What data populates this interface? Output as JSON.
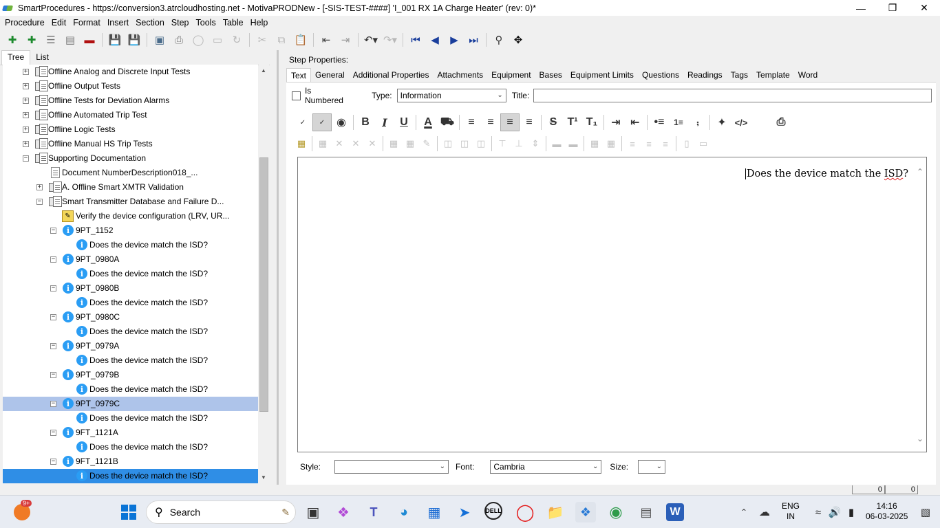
{
  "window": {
    "title": "SmartProcedures - https://conversion3.atrcloudhosting.net - MotivaPRODNew - [-SIS-TEST-####] 'I_001 RX 1A Charge Heater' (rev: 0)*"
  },
  "menu": [
    "Procedure",
    "Edit",
    "Format",
    "Insert",
    "Section",
    "Step",
    "Tools",
    "Table",
    "Help"
  ],
  "left_tabs": [
    "Tree",
    "List"
  ],
  "tree": [
    {
      "label": "Offline Analog and Discrete Input Tests",
      "indent": 0,
      "exp": "+",
      "icon": "doc"
    },
    {
      "label": "Offline Output Tests",
      "indent": 0,
      "exp": "+",
      "icon": "doc"
    },
    {
      "label": "Offline Tests for Deviation Alarms",
      "indent": 0,
      "exp": "+",
      "icon": "doc"
    },
    {
      "label": "Offline Automated Trip Test",
      "indent": 0,
      "exp": "+",
      "icon": "doc"
    },
    {
      "label": "Offline Logic Tests",
      "indent": 0,
      "exp": "+",
      "icon": "doc"
    },
    {
      "label": "Offline Manual HS Trip Tests",
      "indent": 0,
      "exp": "+",
      "icon": "doc"
    },
    {
      "label": "Supporting Documentation",
      "indent": 0,
      "exp": "-",
      "icon": "doc"
    },
    {
      "label": "Document NumberDescription018_...",
      "indent": 1,
      "exp": "",
      "icon": "page"
    },
    {
      "label": "A. Offline Smart XMTR Validation",
      "indent": 1,
      "exp": "+",
      "icon": "doc"
    },
    {
      "label": "Smart Transmitter Database and Failure D...",
      "indent": 1,
      "exp": "-",
      "icon": "doc"
    },
    {
      "label": "Verify the device configuration (LRV, UR...",
      "indent": 2,
      "exp": "",
      "icon": "warn"
    },
    {
      "label": "9PT_1152",
      "indent": 2,
      "exp": "-",
      "icon": "info"
    },
    {
      "label": "Does the device match the ISD?",
      "indent": 3,
      "exp": "",
      "icon": "info"
    },
    {
      "label": "9PT_0980A",
      "indent": 2,
      "exp": "-",
      "icon": "info"
    },
    {
      "label": "Does the device match the ISD?",
      "indent": 3,
      "exp": "",
      "icon": "info"
    },
    {
      "label": "9PT_0980B",
      "indent": 2,
      "exp": "-",
      "icon": "info"
    },
    {
      "label": "Does the device match the ISD?",
      "indent": 3,
      "exp": "",
      "icon": "info"
    },
    {
      "label": "9PT_0980C",
      "indent": 2,
      "exp": "-",
      "icon": "info"
    },
    {
      "label": "Does the device match the ISD?",
      "indent": 3,
      "exp": "",
      "icon": "info"
    },
    {
      "label": "9PT_0979A",
      "indent": 2,
      "exp": "-",
      "icon": "info"
    },
    {
      "label": "Does the device match the ISD?",
      "indent": 3,
      "exp": "",
      "icon": "info"
    },
    {
      "label": "9PT_0979B",
      "indent": 2,
      "exp": "-",
      "icon": "info"
    },
    {
      "label": "Does the device match the ISD?",
      "indent": 3,
      "exp": "",
      "icon": "info"
    },
    {
      "label": "9PT_0979C",
      "indent": 2,
      "exp": "-",
      "icon": "info",
      "state": "sel"
    },
    {
      "label": "Does the device match the ISD?",
      "indent": 3,
      "exp": "",
      "icon": "info"
    },
    {
      "label": "9FT_1121A",
      "indent": 2,
      "exp": "-",
      "icon": "info"
    },
    {
      "label": "Does the device match the ISD?",
      "indent": 3,
      "exp": "",
      "icon": "info"
    },
    {
      "label": "9FT_1121B",
      "indent": 2,
      "exp": "-",
      "icon": "info"
    },
    {
      "label": "Does the device match the ISD?",
      "indent": 3,
      "exp": "",
      "icon": "info",
      "state": "sel2"
    }
  ],
  "step": {
    "header": "Step Properties:",
    "tabs": [
      "Text",
      "General",
      "Additional Properties",
      "Attachments",
      "Equipment",
      "Bases",
      "Equipment Limits",
      "Questions",
      "Readings",
      "Tags",
      "Template",
      "Word"
    ],
    "is_numbered_label": "Is Numbered",
    "type_label": "Type:",
    "type_value": "Information",
    "title_label": "Title:",
    "title_value": "",
    "content_text_a": "Does the device match the ",
    "content_text_b": "ISD",
    "content_text_c": "?",
    "style_label": "Style:",
    "style_value": "",
    "font_label": "Font:",
    "font_value": "Cambria",
    "size_label": "Size:",
    "size_value": ""
  },
  "status": {
    "cell1": "0",
    "cell2": "0"
  },
  "taskbar": {
    "search_placeholder": "Search",
    "badge": "9+",
    "lang1": "ENG",
    "lang2": "IN",
    "time": "14:16",
    "date": "06-03-2025"
  }
}
